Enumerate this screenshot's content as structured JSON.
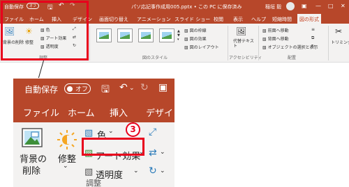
{
  "top": {
    "autosave": "自動保存",
    "autosave_state": "オフ",
    "file_title": "パソ応記事作成用005.pptx • この PC に保存済み",
    "user": "稲垣 毅",
    "tabs": [
      "ファイル",
      "ホーム",
      "挿入",
      "デザイン",
      "画面切り替え",
      "アニメーション",
      "スライド ショー",
      "校閲",
      "表示",
      "ヘルプ",
      "短縮時間",
      "図の形式"
    ],
    "active_tab": "図の形式",
    "ribbon": {
      "remove_bg": "背景の削除",
      "fix": "修整",
      "color": "色",
      "art_effects": "アート効果",
      "transparency": "透明度",
      "adjust_group": "調整",
      "picture_styles_group": "図のスタイル",
      "border": "図の枠線",
      "effects": "図の効果",
      "layout": "図のレイアウト",
      "alt_text": "代替テキスト",
      "accessibility_group": "アクセシビリティ",
      "bring_forward": "前面へ移動",
      "send_backward": "背面へ移動",
      "selection_pane": "オブジェクトの選択と表示",
      "arrange_group": "配置",
      "crop": "トリミング"
    }
  },
  "zoom": {
    "autosave": "自動保存",
    "autosave_state": "オフ",
    "tabs": [
      "ファイル",
      "ホーム",
      "挿入",
      "デザイン"
    ],
    "remove_bg": "背景の",
    "remove_bg2": "削除",
    "fix": "修整",
    "color": "色",
    "art_effects": "アート効果",
    "transparency": "透明度",
    "adjust_group": "調整",
    "step_number": "3"
  },
  "colors": {
    "accent": "#b7472a",
    "highlight": "#e8001c"
  }
}
